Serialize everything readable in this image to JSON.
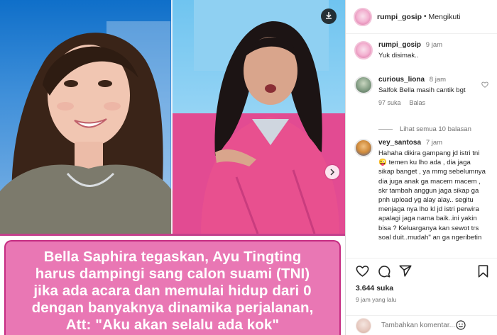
{
  "post": {
    "caption_overlay": "Bella Saphira tegaskan, Ayu Tingting\nharus dampingi sang calon suami (TNI)\njika ada acara dan memulai hidup dari 0\ndengan banyaknya dinamika perjalanan,\nAtt:  \"Aku akan selalu ada kok\"",
    "download_icon": "download-icon",
    "next_icon": "chevron-right-icon"
  },
  "header": {
    "username": "rumpi_gosip",
    "separator": "•",
    "follow_label": "Mengikuti"
  },
  "comments": [
    {
      "username": "rumpi_gosip",
      "time": "9 jam",
      "text": "Yuk disimak.."
    },
    {
      "username": "curious_liona",
      "time": "8 jam",
      "text": "Salfok Bella masih cantik bgt",
      "likes": "97 suka",
      "reply_label": "Balas",
      "view_replies": "Lihat semua 10 balasan"
    },
    {
      "username": "vey_santosa",
      "time": "7 jam",
      "text": "Hahaha dikira gampang jd istri tni\n😜 temen ku lho ada , dia jaga\nsikap banget , ya mmg sebelumnya\ndia juga anak ga macem macem ,\nskr tambah anggun jaga sikap ga\npnh upload yg alay alay.. segitu\nmenjaga nya lho kl jd istri perwira\napalagi jaga nama baik..ini yakin\nbisa ? Keluarganya kan sewot trs\nsoal duit..mudah\" an ga ngeribetin"
    }
  ],
  "actions": {
    "likes_count": "3.644 suka",
    "posted_ago": "9 jam yang lalu",
    "add_comment_placeholder": "Tambahkan komentar..."
  },
  "colors": {
    "caption_bg": "#e977b4",
    "caption_border": "#c52c82",
    "text_primary": "#262626",
    "text_secondary": "#737373"
  }
}
